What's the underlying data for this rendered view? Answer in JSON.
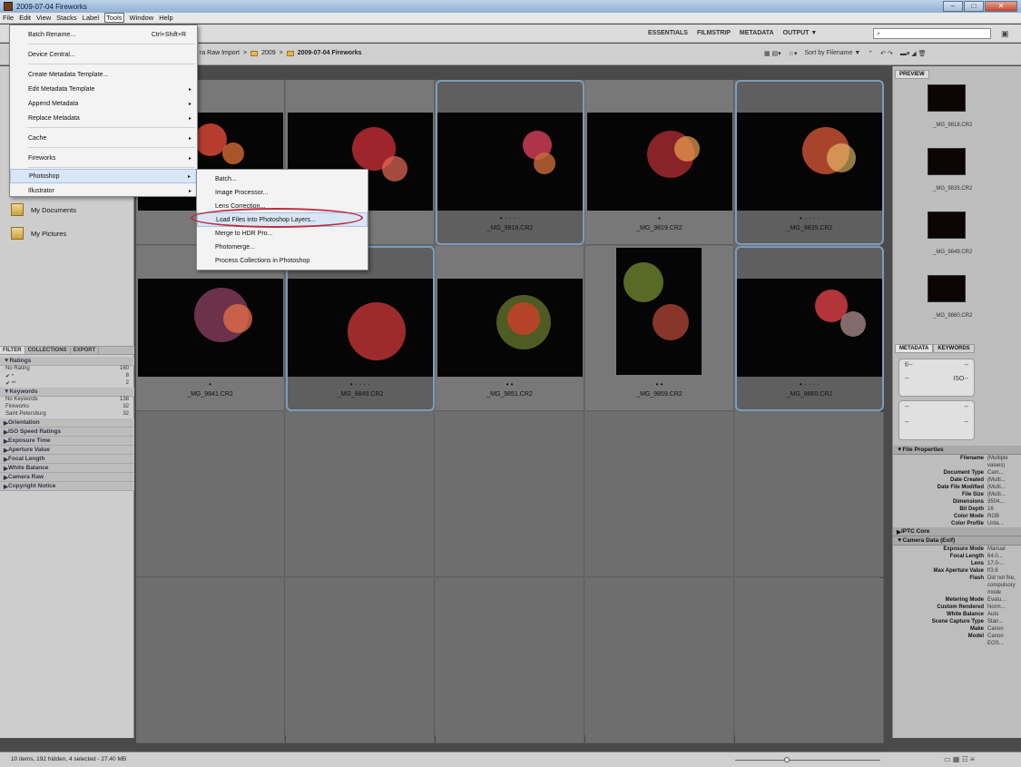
{
  "window": {
    "title": "2009-07-04 Fireworks"
  },
  "menubar": [
    "File",
    "Edit",
    "View",
    "Stacks",
    "Label",
    "Tools",
    "Window",
    "Help"
  ],
  "workspaces": [
    "ESSENTIALS",
    "FILMSTRIP",
    "METADATA",
    "OUTPUT ▼"
  ],
  "breadcrumb": [
    "ra Raw Import",
    "2009",
    "2009-07-04 Fireworks"
  ],
  "sort_label": "Sort by Filename ▼",
  "tools_menu": [
    {
      "label": "Batch Rename...",
      "shortcut": "Ctrl+Shift+R"
    },
    {
      "label": "Device Central..."
    },
    {
      "label": "Create Metadata Template..."
    },
    {
      "label": "Edit Metadata Template",
      "arrow": "▸"
    },
    {
      "label": "Append Metadata",
      "arrow": "▸"
    },
    {
      "label": "Replace Metadata",
      "arrow": "▸"
    },
    {
      "label": "Cache",
      "arrow": "▸"
    },
    {
      "label": "Fireworks",
      "arrow": "▸"
    },
    {
      "label": "Photoshop",
      "arrow": "▸"
    },
    {
      "label": "Illustrator",
      "arrow": "▸"
    }
  ],
  "photoshop_submenu": [
    "Batch...",
    "Image Processor...",
    "Lens Correction...",
    "Load Files into Photoshop Layers...",
    "Merge to HDR Pro...",
    "Photomerge...",
    "Process Collections in Photoshop"
  ],
  "favorites": [
    "My Documents",
    "My Pictures"
  ],
  "left_tabs": [
    "FILTER",
    "COLLECTIONS",
    "EXPORT"
  ],
  "filters": {
    "ratings_title": "Ratings",
    "ratings": [
      {
        "label": "No Rating",
        "count": "160"
      },
      {
        "label": "✔ *",
        "count": "8"
      },
      {
        "label": "✔ **",
        "count": "2"
      }
    ],
    "keywords_title": "Keywords",
    "keywords": [
      {
        "label": "No Keywords",
        "count": "138"
      },
      {
        "label": "Fireworks",
        "count": "32"
      },
      {
        "label": "Saint Petersburg",
        "count": "32"
      }
    ],
    "collapsed": [
      "Orientation",
      "ISO Speed Ratings",
      "Exposure Time",
      "Aperture Value",
      "Focal Length",
      "White Balance",
      "Camera Raw",
      "Copyright Notice"
    ]
  },
  "thumbs": [
    {
      "name": "",
      "stars": ""
    },
    {
      "name": "5.CR2",
      "stars": ""
    },
    {
      "name": "_MG_9818.CR2",
      "stars": "• · · · ·"
    },
    {
      "name": "_MG_9819.CR2",
      "stars": "•"
    },
    {
      "name": "_MG_9835.CR2",
      "stars": "• · · · ·"
    },
    {
      "name": "_MG_9841.CR2",
      "stars": "•"
    },
    {
      "name": "_MG_9849.CR2",
      "stars": "• · · · ·"
    },
    {
      "name": "_MG_9851.CR2",
      "stars": "• •"
    },
    {
      "name": "_MG_9859.CR2",
      "stars": "• •"
    },
    {
      "name": "_MG_9860.CR2",
      "stars": "• · · · ·"
    }
  ],
  "right_panel": {
    "preview_tab": "PREVIEW",
    "preview_labels": [
      "_MG_9818.CR2",
      "_MG_9835.CR2",
      "_MG_9849.CR2",
      "_MG_9860.CR2"
    ],
    "meta_tabs": [
      "METADATA",
      "KEYWORDS"
    ],
    "exif_a": [
      "f/--",
      "--",
      "--",
      "ISO--"
    ],
    "exif_b": [
      "--",
      "--",
      "--",
      "--"
    ],
    "file_props_title": "File Properties",
    "file_props": [
      {
        "k": "Filename",
        "v": "(Multiple values)"
      },
      {
        "k": "Document Type",
        "v": "Cam..."
      },
      {
        "k": "Date Created",
        "v": "(Multi..."
      },
      {
        "k": "Date File Modified",
        "v": "(Multi..."
      },
      {
        "k": "File Size",
        "v": "(Multi..."
      },
      {
        "k": "Dimensions",
        "v": "3504..."
      },
      {
        "k": "Bit Depth",
        "v": "16"
      },
      {
        "k": "Color Mode",
        "v": "RGB"
      },
      {
        "k": "Color Profile",
        "v": "Unta..."
      }
    ],
    "iptc_title": "IPTC Core",
    "camera_title": "Camera Data (Exif)",
    "camera_props": [
      {
        "k": "Exposure Mode",
        "v": "Manual"
      },
      {
        "k": "Focal Length",
        "v": "64.0..."
      },
      {
        "k": "Lens",
        "v": "17.0-..."
      },
      {
        "k": "Max Aperture Value",
        "v": "f/3.6"
      },
      {
        "k": "Flash",
        "v": "Did not fire, compulsory mode"
      },
      {
        "k": "Metering Mode",
        "v": "Evalu..."
      },
      {
        "k": "Custom Rendered",
        "v": "Norm..."
      },
      {
        "k": "White Balance",
        "v": "Auto"
      },
      {
        "k": "Scene Capture Type",
        "v": "Stan..."
      },
      {
        "k": "Make",
        "v": "Canon"
      },
      {
        "k": "Model",
        "v": "Canon EOS..."
      }
    ]
  },
  "status": "10 items, 192 hidden, 4 selected - 27.40 MB",
  "colors": {
    "accent": "#7c9cba",
    "highlight_ring": "#c0283a"
  }
}
